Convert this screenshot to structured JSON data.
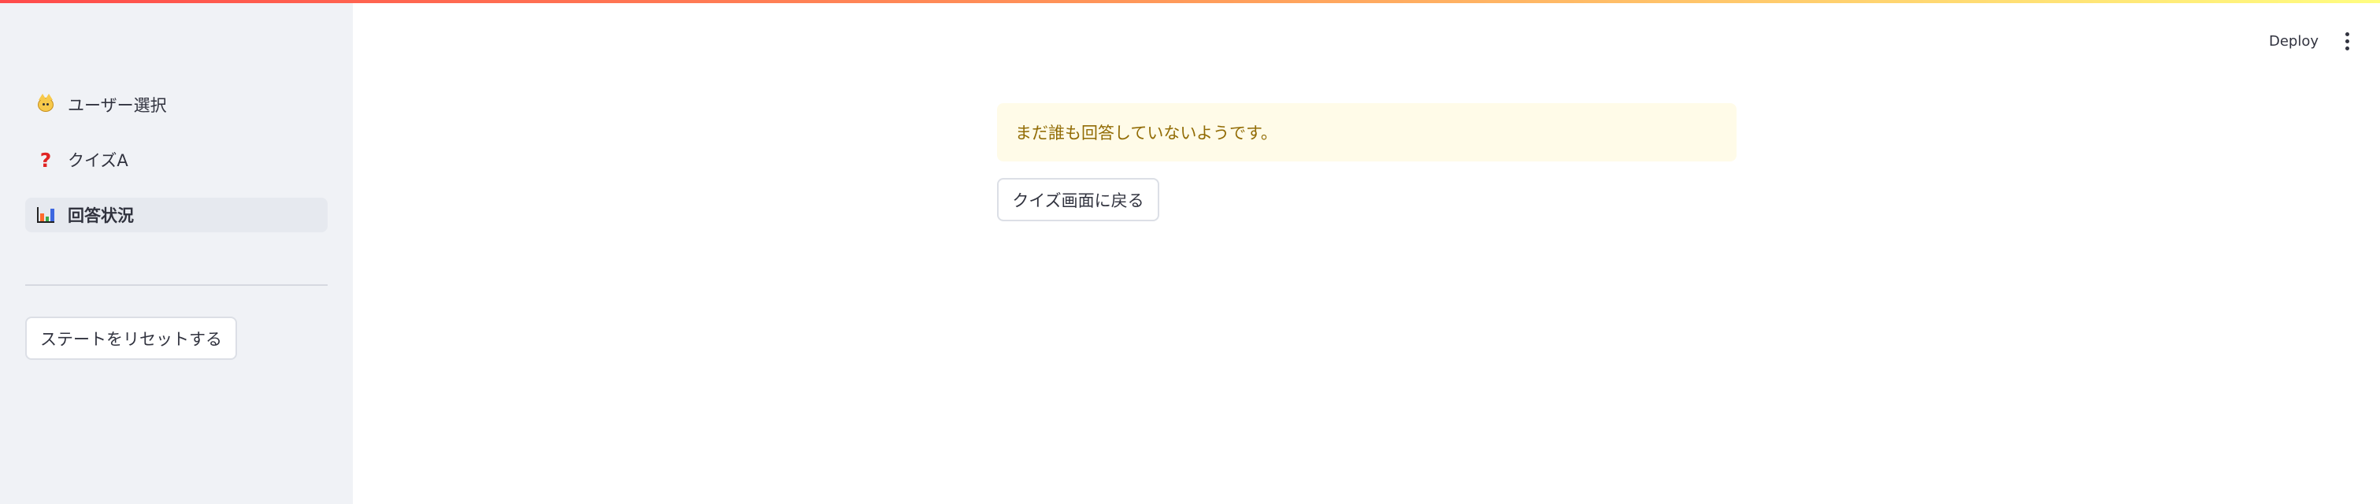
{
  "sidebar": {
    "nav_items": [
      {
        "label": "ユーザー選択",
        "icon": "cat-face-icon"
      },
      {
        "label": "クイズA",
        "icon": "red-question-mark-icon"
      },
      {
        "label": "回答状況",
        "icon": "bar-chart-icon",
        "active": true
      }
    ],
    "reset_button_label": "ステートをリセットする"
  },
  "header": {
    "deploy_label": "Deploy",
    "menu_icon": "more-vertical-icon"
  },
  "main": {
    "message": "まだ誰も回答していないようです。",
    "back_button_label": "クイズ画面に戻る"
  },
  "colors": {
    "sidebar_background": "#f0f2f6",
    "active_item_background": "#e6e9ef",
    "warning_background": "#fffbe8",
    "warning_text": "#926c05"
  }
}
